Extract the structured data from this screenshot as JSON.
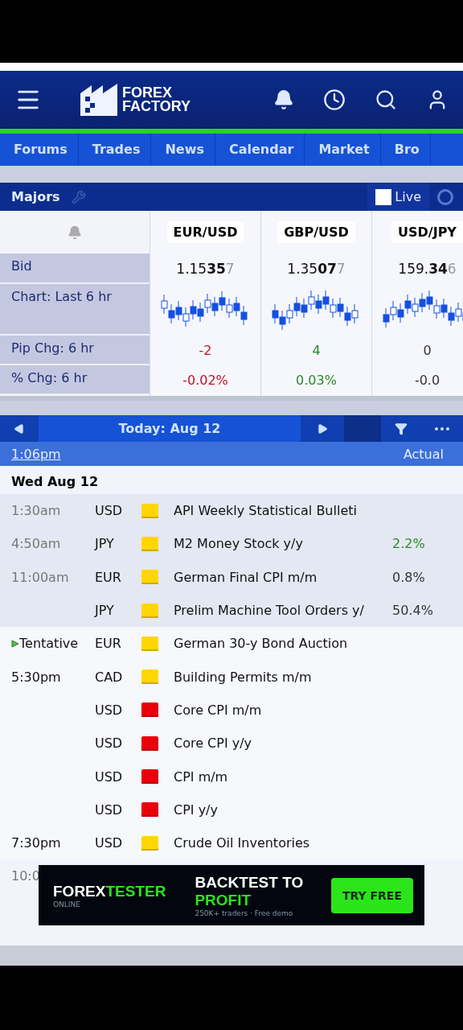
{
  "header": {
    "logo": [
      "FOREX",
      "FACTORY"
    ]
  },
  "nav": [
    "Forums",
    "Trades",
    "News",
    "Calendar",
    "Market",
    "Bro"
  ],
  "market_bar": {
    "title": "Majors",
    "live_label": "Live",
    "live_checked": false
  },
  "market": {
    "row_labels": [
      "Bid",
      "Chart: Last 6 hr",
      "Pip Chg: 6 hr",
      "% Chg: 6 hr"
    ],
    "pairs": [
      {
        "name": "EUR/USD",
        "bid": [
          "1.15",
          "35",
          "7"
        ],
        "pip": "-2",
        "pct": "-0.02%",
        "rising": false,
        "falling": true
      },
      {
        "name": "GBP/USD",
        "bid": [
          "1.35",
          "07",
          "7"
        ],
        "pip": "4",
        "pct": "0.03%",
        "rising": true,
        "falling": false
      },
      {
        "name": "USD/JPY",
        "bid": [
          "159.",
          "34",
          "6"
        ],
        "pip": "0",
        "pct": "-0.0",
        "rising": false,
        "falling": false
      }
    ]
  },
  "calendar": {
    "date_label": "Today: Aug 12",
    "time_now": "1:06pm",
    "actual_header": "Actual",
    "day": "Wed Aug 12",
    "rows": [
      {
        "time": "1:30am",
        "past": true,
        "currency": "USD",
        "color": "#ffd600",
        "event": "API Weekly Statistical Bulleti"
      },
      {
        "time": "4:50am",
        "past": true,
        "currency": "JPY",
        "color": "#ffd600",
        "event": "M2 Money Stock y/y",
        "actual": "2.2%",
        "better": true
      },
      {
        "time": "11:00am",
        "past": true,
        "currency": "EUR",
        "color": "#ffd600",
        "event": "German Final CPI m/m",
        "actual": "0.8%",
        "better": false
      },
      {
        "time": "",
        "past": true,
        "currency": "JPY",
        "color": "#ffd600",
        "event": "Prelim Machine Tool Orders y/",
        "actual": "50.4%",
        "better": false
      },
      {
        "time": "Tentative",
        "past": false,
        "tentative": true,
        "currency": "EUR",
        "color": "#ffd600",
        "event": "German 30-y Bond Auction"
      },
      {
        "time": "5:30pm",
        "past": false,
        "currency": "CAD",
        "color": "#ffd600",
        "event": "Building Permits m/m"
      },
      {
        "time": "",
        "past": false,
        "currency": "USD",
        "color": "#e8000b",
        "event": "Core CPI m/m"
      },
      {
        "time": "",
        "past": false,
        "currency": "USD",
        "color": "#e8000b",
        "event": "Core CPI y/y"
      },
      {
        "time": "",
        "past": false,
        "currency": "USD",
        "color": "#e8000b",
        "event": "CPI m/m"
      },
      {
        "time": "",
        "past": false,
        "currency": "USD",
        "color": "#e8000b",
        "event": "CPI y/y"
      },
      {
        "time": "7:30pm",
        "past": false,
        "currency": "USD",
        "color": "#ffd600",
        "event": "Crude Oil Inventories"
      }
    ],
    "partial_time": "10:0"
  },
  "ad": {
    "brand": [
      "FOREX",
      "TESTER"
    ],
    "brand_sub": "ONLINE",
    "headline": [
      "BACKTEST TO ",
      "PROFIT"
    ],
    "subline": "250K+ traders · Free demo",
    "cta": "TRY FREE"
  }
}
